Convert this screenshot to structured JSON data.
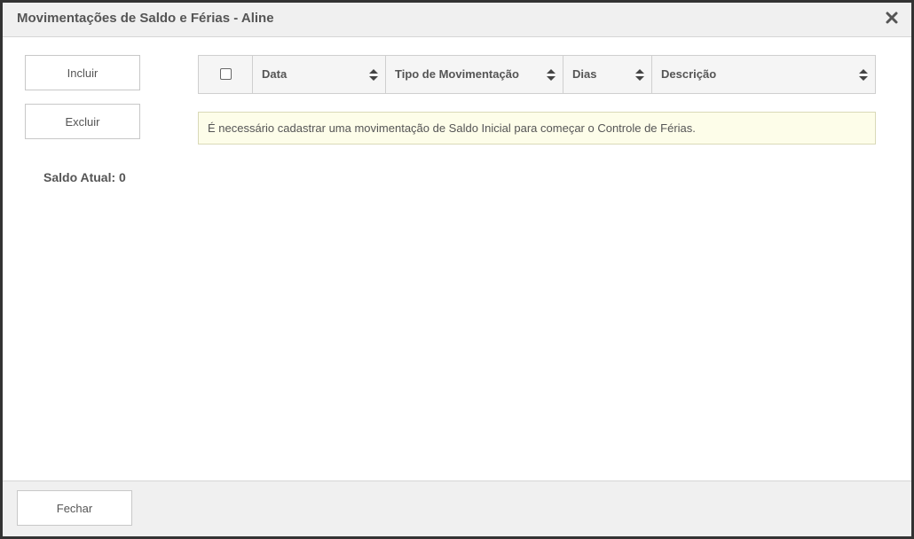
{
  "dialog": {
    "title": "Movimentações de Saldo e Férias - Aline",
    "close_icon": "close-icon"
  },
  "actions": {
    "incluir_label": "Incluir",
    "excluir_label": "Excluir"
  },
  "saldo": {
    "text": "Saldo Atual: 0"
  },
  "table": {
    "columns": [
      "Data",
      "Tipo de Movimentação",
      "Dias",
      "Descrição"
    ],
    "rows": []
  },
  "notice": {
    "text": "É necessário cadastrar uma movimentação de Saldo Inicial para começar o Controle de Férias."
  },
  "footer": {
    "fechar_label": "Fechar"
  }
}
